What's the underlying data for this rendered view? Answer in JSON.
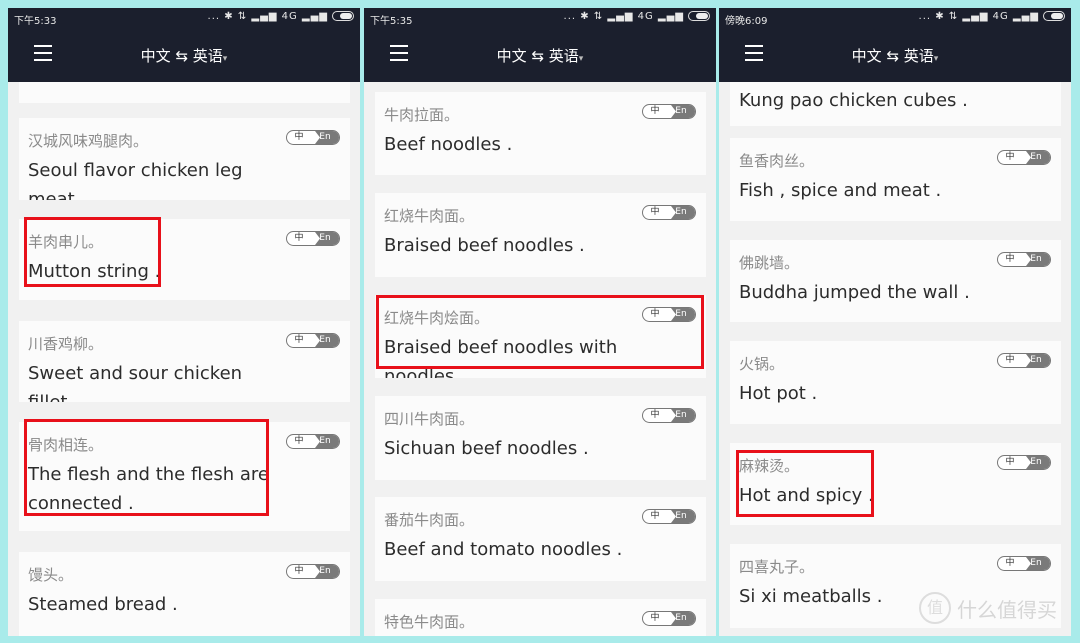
{
  "header": {
    "title": "中文 ⇆ 英语",
    "caret": "▾"
  },
  "toggle": {
    "zh": "中",
    "en": "En"
  },
  "status_icons": "... ✱ ⇅ ▂▄▆ 4G ▂▄▆",
  "panels": [
    {
      "time": "下午5:33",
      "items": [
        {
          "zh": "",
          "en": ""
        },
        {
          "zh": "汉城风味鸡腿肉。",
          "en": "Seoul flavor chicken leg meat ."
        },
        {
          "zh": "羊肉串儿。",
          "en": "Mutton string .",
          "highlight": true
        },
        {
          "zh": "川香鸡柳。",
          "en": "Sweet and sour chicken fillet ."
        },
        {
          "zh": "骨肉相连。",
          "en": "The flesh and the flesh are connected .",
          "highlight": true
        },
        {
          "zh": "馒头。",
          "en": "Steamed bread ."
        }
      ]
    },
    {
      "time": "下午5:35",
      "items": [
        {
          "zh": "牛肉拉面。",
          "en": "Beef noodles ."
        },
        {
          "zh": "红烧牛肉面。",
          "en": "Braised beef noodles ."
        },
        {
          "zh": "红烧牛肉烩面。",
          "en": "Braised beef noodles with noodles .",
          "highlight": true
        },
        {
          "zh": "四川牛肉面。",
          "en": "Sichuan beef noodles ."
        },
        {
          "zh": "番茄牛肉面。",
          "en": "Beef and tomato noodles ."
        },
        {
          "zh": "特色牛肉面。",
          "en": ""
        }
      ]
    },
    {
      "time": "傍晚6:09",
      "items": [
        {
          "zh": "",
          "en": "Kung pao chicken cubes ."
        },
        {
          "zh": "鱼香肉丝。",
          "en": "Fish , spice and meat ."
        },
        {
          "zh": "佛跳墙。",
          "en": "Buddha jumped the wall ."
        },
        {
          "zh": "火锅。",
          "en": "Hot pot ."
        },
        {
          "zh": "麻辣烫。",
          "en": "Hot and spicy .",
          "highlight": true
        },
        {
          "zh": "四喜丸子。",
          "en": "Si xi meatballs ."
        }
      ]
    }
  ],
  "watermark": {
    "logo": "值",
    "text": "什么值得买"
  },
  "colors": {
    "appbar": "#1b1f2d",
    "highlight": "#e8101a",
    "background": "#a9ebea"
  }
}
